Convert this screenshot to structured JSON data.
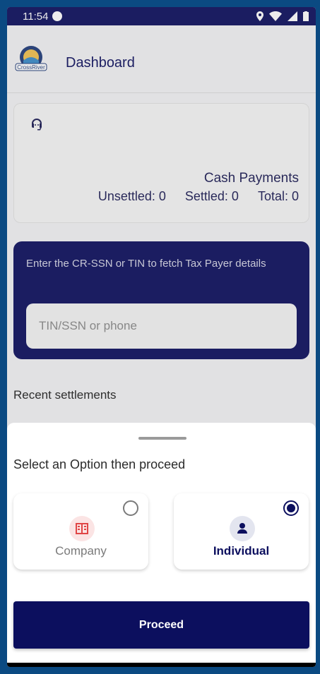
{
  "status_bar": {
    "time": "11:54"
  },
  "header": {
    "title": "Dashboard",
    "logo_text": "CrossRiver"
  },
  "summary_card": {
    "title": "Cash Payments",
    "unsettled": "Unsettled: 0",
    "settled": "Settled: 0",
    "total": "Total: 0"
  },
  "fetch_card": {
    "label": "Enter the CR-SSN or TIN to fetch Tax Payer details",
    "input_placeholder": "TIN/SSN or phone"
  },
  "recent": {
    "title": "Recent settlements"
  },
  "sheet": {
    "title": "Select an Option then proceed",
    "options": [
      {
        "label": "Company",
        "icon": "building-icon",
        "selected": false
      },
      {
        "label": "Individual",
        "icon": "person-icon",
        "selected": true
      }
    ],
    "proceed_label": "Proceed"
  },
  "colors": {
    "primary": "#0c0f5e",
    "company_icon": "#e04646",
    "background": "#0b4a82"
  }
}
